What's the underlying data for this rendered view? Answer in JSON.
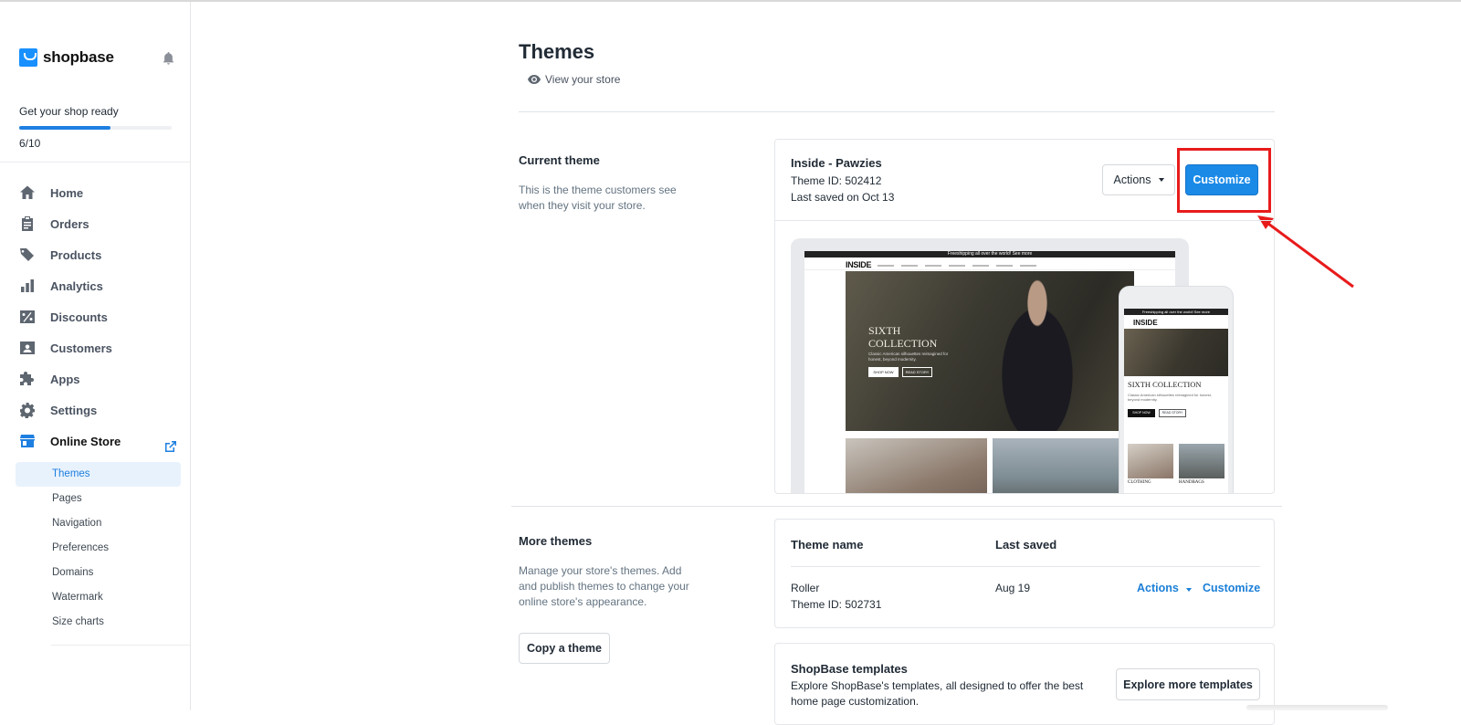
{
  "sidebar": {
    "logo_text": "shopbase",
    "progress_label": "Get your shop ready",
    "progress_fraction": 0.6,
    "progress_count": "6/10",
    "nav": [
      {
        "label": "Home",
        "icon": "home-icon"
      },
      {
        "label": "Orders",
        "icon": "clipboard-icon"
      },
      {
        "label": "Products",
        "icon": "tag-icon"
      },
      {
        "label": "Analytics",
        "icon": "bar-chart-icon"
      },
      {
        "label": "Discounts",
        "icon": "discount-icon"
      },
      {
        "label": "Customers",
        "icon": "customers-icon"
      },
      {
        "label": "Apps",
        "icon": "puzzle-icon"
      },
      {
        "label": "Settings",
        "icon": "gear-icon"
      },
      {
        "label": "Online Store",
        "icon": "store-icon"
      }
    ],
    "sub_nav": [
      "Themes",
      "Pages",
      "Navigation",
      "Preferences",
      "Domains",
      "Watermark",
      "Size charts"
    ]
  },
  "header": {
    "title": "Themes",
    "view_store": "View your store"
  },
  "current_theme": {
    "section_title": "Current theme",
    "section_desc": "This is the theme customers see when they visit your store.",
    "name": "Inside - Pawzies",
    "theme_id": "Theme ID: 502412",
    "last_saved": "Last saved on Oct 13",
    "actions_label": "Actions",
    "customize_label": "Customize"
  },
  "preview": {
    "promo_text": "Freeshipping all over the world! See more",
    "logo": "INSIDE",
    "hero_title_line1": "SIXTH",
    "hero_title_line2": "COLLECTION",
    "hero_sub": "Classic American silhouettes reimagined for honest, beyond modernity.",
    "shop_now": "SHOP NOW",
    "read_story": "READ STORY",
    "mobile_title": "SIXTH COLLECTION",
    "cap_clothing": "CLOTHING",
    "cap_handbags": "HANDBAGS"
  },
  "more_themes": {
    "section_title": "More themes",
    "section_desc": "Manage your store's themes. Add and publish themes to change your online store's appearance.",
    "copy_button": "Copy a theme",
    "col_name": "Theme name",
    "col_saved": "Last saved",
    "rows": [
      {
        "name": "Roller",
        "theme_id": "Theme ID: 502731",
        "last_saved": "Aug 19",
        "actions": "Actions",
        "customize": "Customize"
      }
    ]
  },
  "templates": {
    "title": "ShopBase templates",
    "desc": "Explore ShopBase's templates, all designed to offer the best home page customization.",
    "button": "Explore more templates"
  },
  "colors": {
    "accent": "#1b8ae7",
    "highlight": "#e81b1b"
  }
}
